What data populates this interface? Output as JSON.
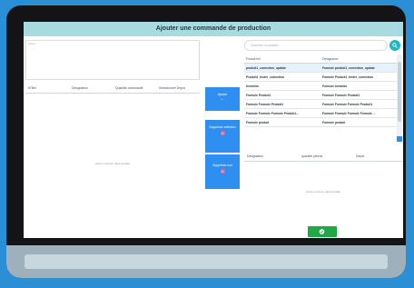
{
  "window": {
    "title": "Ajouter une commande de production"
  },
  "left": {
    "notes_placeholder": "Notes",
    "columns": [
      "N°Bel",
      "Désignation",
      "Quantité commandé",
      "Sélectionner Dépot"
    ],
    "empty_message": "Aucun contenu dans la table"
  },
  "actions": {
    "add_label": "Ajouter",
    "remove_selected_label": "Supprimer sélection",
    "remove_all_label": "Supprimer tout"
  },
  "right": {
    "search_placeholder": "Chercher un produit...",
    "product_columns": [
      "Produit fini",
      "Désignation"
    ],
    "products": [
      {
        "name": "produit1_correction_update",
        "designation": "Formule produit1_correction_update"
      },
      {
        "name": "Produit1_tester_correction",
        "designation": "Formule Produit1_tester_correction"
      },
      {
        "name": "Kemmim",
        "designation": "Formule kemmim"
      },
      {
        "name": "Formule Produit1",
        "designation": "Formule Formule Produit1"
      },
      {
        "name": "Formule Formule Produit1",
        "designation": "Formule Formule Formule Produit1"
      },
      {
        "name": "Formule Formule Formule Produit1...",
        "designation": "Formule Formule Formule Formule ..."
      },
      {
        "name": "Formule produit",
        "designation": "Formule produit"
      }
    ],
    "selection_columns": [
      "Désignation",
      "quantité prévue",
      "Dépot"
    ],
    "selection_empty_message": "Aucun contenu dans la table"
  },
  "colors": {
    "title_bar": "#a8dbe0",
    "action_button": "#2f8ff0",
    "validate_button": "#23a847",
    "search_button": "#1eb7c4"
  }
}
